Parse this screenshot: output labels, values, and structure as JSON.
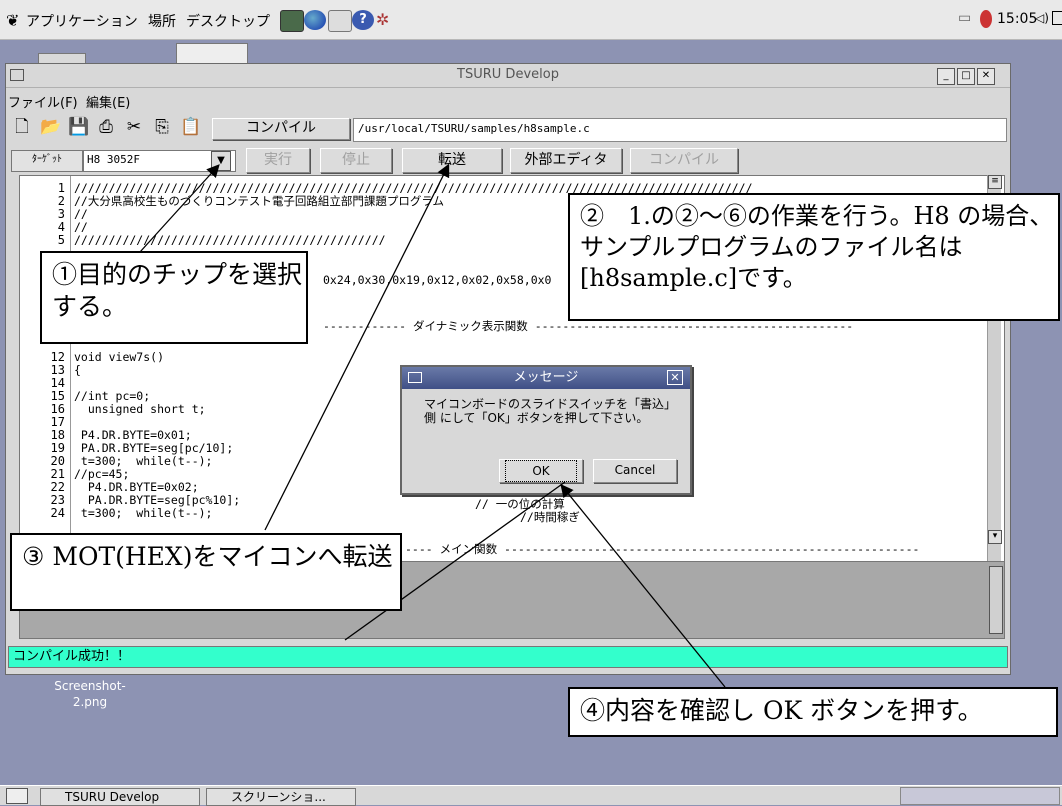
{
  "top_panel": {
    "menu_apps": "アプリケーション",
    "menu_places": "場所",
    "menu_desktop": "デスクトップ",
    "clock": "15:05"
  },
  "window": {
    "title": "TSURU Develop",
    "menus": [
      "ファイル(F)",
      "編集(E)"
    ],
    "compile_label": "コンパイル",
    "file_path": "/usr/local/TSURU/samples/h8sample.c",
    "target_label": "ﾀｰｹﾞｯﾄ",
    "target_value": "H8 3052F",
    "buttons": [
      "実行",
      "停止",
      "転送",
      "外部エディタ",
      "コンパイル"
    ],
    "status": "コンパイル成功！！"
  },
  "code_lines": [
    {
      "n": "1",
      "t": "//////////////////////////////////////////////////////////////////////////////////////////////////"
    },
    {
      "n": "2",
      "t": "//大分県高校生ものづくりコンテスト電子回路組立部門課題プログラム"
    },
    {
      "n": "3",
      "t": "//"
    },
    {
      "n": "4",
      "t": "//"
    },
    {
      "n": "5",
      "t": "/////////////////////////////////////////////"
    },
    {
      "n": "12",
      "t": "void view7s()"
    },
    {
      "n": "13",
      "t": "{"
    },
    {
      "n": "14",
      "t": ""
    },
    {
      "n": "15",
      "t": "//int pc=0;"
    },
    {
      "n": "16",
      "t": "  unsigned short t;"
    },
    {
      "n": "17",
      "t": ""
    },
    {
      "n": "18",
      "t": " P4.DR.BYTE=0x01;"
    },
    {
      "n": "19",
      "t": " PA.DR.BYTE=seg[pc/10];"
    },
    {
      "n": "20",
      "t": " t=300;  while(t--);"
    },
    {
      "n": "21",
      "t": "//pc=45;"
    },
    {
      "n": "22",
      "t": "  P4.DR.BYTE=0x02;"
    },
    {
      "n": "23",
      "t": "  PA.DR.BYTE=seg[pc%10];"
    },
    {
      "n": "24",
      "t": " t=300;  while(t--);"
    }
  ],
  "code_fragments": {
    "hex": "0x24,0x30,0x19,0x12,0x02,0x58,0x0",
    "section_dynamic": "------------ ダイナミック表示関数 ----------------------------------------------",
    "section_main": "---- メイン関数 ------------------------------------------------------------",
    "comment_ones": "// 一の位の計算",
    "comment_wait": "//時間稼ぎ"
  },
  "dialog": {
    "title": "メッセージ",
    "message": "マイコンボードのスライドスイッチを「書込」側 にして「OK」ボタンを押して下さい。",
    "ok": "OK",
    "cancel": "Cancel"
  },
  "callouts": {
    "c1": "①目的のチップを選択する。",
    "c2": "②　1.の②～⑥の作業を行う。H8 の場合、サンプルプログラムのファイル名は[h8sample.c]です。",
    "c3": "③ MOT(HEX)をマイコンへ転送",
    "c4": "④内容を確認し OK ボタンを押す。"
  },
  "desktop": {
    "icon_label": "Screenshot-2.png"
  },
  "taskbar": {
    "task1": "TSURU Develop",
    "task2": "スクリーンショ..."
  }
}
